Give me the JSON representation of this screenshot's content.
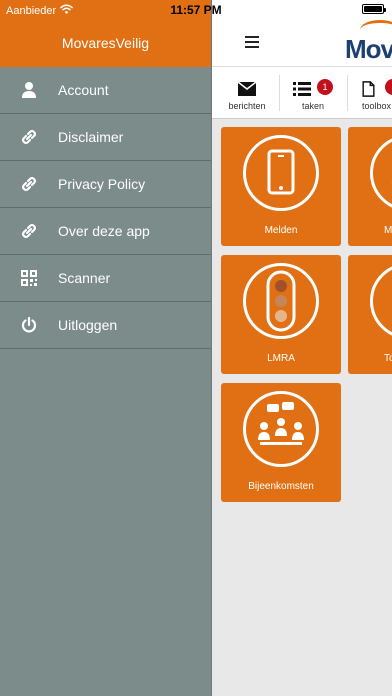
{
  "status_bar": {
    "carrier": "Aanbieder",
    "time": "11:57 PM"
  },
  "sidebar": {
    "title": "MovaresVeilig",
    "items": [
      {
        "label": "Account",
        "icon": "person-icon"
      },
      {
        "label": "Disclaimer",
        "icon": "link-icon"
      },
      {
        "label": "Privacy Policy",
        "icon": "link-icon"
      },
      {
        "label": "Over deze app",
        "icon": "link-icon"
      },
      {
        "label": "Scanner",
        "icon": "qr-code-icon"
      },
      {
        "label": "Uitloggen",
        "icon": "power-icon"
      }
    ]
  },
  "header": {
    "logo_text": "Mov"
  },
  "tabs": [
    {
      "label": "berichten",
      "icon": "envelope-icon"
    },
    {
      "label": "taken",
      "icon": "list-icon",
      "badge": "1"
    },
    {
      "label": "toolbox",
      "icon": "document-icon"
    }
  ],
  "tiles": [
    {
      "label": "Melden",
      "icon": "phone-icon"
    },
    {
      "label": "M",
      "icon": "partial-icon"
    },
    {
      "label": "LMRA",
      "icon": "traffic-light-icon"
    },
    {
      "label": "To",
      "icon": "partial-icon"
    },
    {
      "label": "Bijeenkomsten",
      "icon": "meeting-icon"
    }
  ],
  "colors": {
    "accent": "#e07013",
    "sidebar_bg": "#7c8c8b",
    "badge": "#c0111c",
    "logo": "#1c3f74"
  }
}
